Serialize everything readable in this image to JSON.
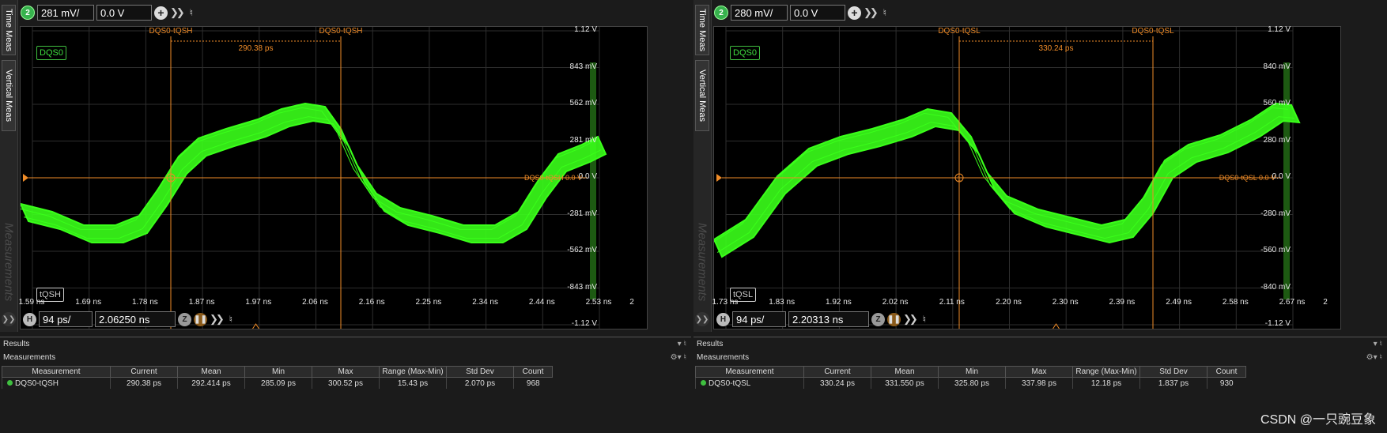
{
  "colors": {
    "trace": "#3aff1a",
    "cursor": "#f08c28",
    "accent": "#3fbf3f"
  },
  "panels": [
    {
      "side_tabs": [
        "Time Meas",
        "Vertical Meas",
        "Measurements"
      ],
      "top": {
        "channel": "2",
        "scale": "281 mV/",
        "offset": "0.0 V"
      },
      "channel_label": "DQS0",
      "meas_label": "tQSH",
      "cursor_label_left": "DQS0-tQSH",
      "cursor_label_right": "DQS0-tQSH",
      "delta_label": "290.38 ps",
      "ground_marker": "DQS0-tQSH 0.0 V",
      "y_labels": [
        "1.12 V",
        "843 mV",
        "562 mV",
        "281 mV",
        "0.0 V",
        "-281 mV",
        "-562 mV",
        "-843 mV",
        "-1.12 V"
      ],
      "x_labels": [
        "1.59 ns",
        "1.69 ns",
        "1.78 ns",
        "1.87 ns",
        "1.97 ns",
        "2.06 ns",
        "2.16 ns",
        "2.25 ns",
        "2.34 ns",
        "2.44 ns",
        "2.53 ns"
      ],
      "x_suffix": "2",
      "bottom": {
        "h": "H",
        "scale": "94 ps/",
        "position": "2.06250 ns"
      },
      "results": {
        "title": "Results",
        "subtitle": "Measurements",
        "columns": [
          "Measurement",
          "Current",
          "Mean",
          "Min",
          "Max",
          "Range (Max-Min)",
          "Std Dev",
          "Count"
        ],
        "row": [
          "DQS0-tQSH",
          "290.38 ps",
          "292.414 ps",
          "285.09 ps",
          "300.52 ps",
          "15.43 ps",
          "2.070 ps",
          "968"
        ]
      }
    },
    {
      "side_tabs": [
        "Time Meas",
        "Vertical Meas",
        "Measurements"
      ],
      "top": {
        "channel": "2",
        "scale": "280 mV/",
        "offset": "0.0 V"
      },
      "channel_label": "DQS0",
      "meas_label": "tQSL",
      "cursor_label_left": "DQS0-tQSL",
      "cursor_label_right": "DQS0-tQSL",
      "delta_label": "330.24 ps",
      "ground_marker": "DQS0-tQSL 0.0 V",
      "y_labels": [
        "1.12 V",
        "840 mV",
        "560 mV",
        "280 mV",
        "0.0 V",
        "-280 mV",
        "-560 mV",
        "-840 mV",
        "-1.12 V"
      ],
      "x_labels": [
        "1.73 ns",
        "1.83 ns",
        "1.92 ns",
        "2.02 ns",
        "2.11 ns",
        "2.20 ns",
        "2.30 ns",
        "2.39 ns",
        "2.49 ns",
        "2.58 ns",
        "2.67 ns"
      ],
      "x_suffix": "2",
      "bottom": {
        "h": "H",
        "scale": "94 ps/",
        "position": "2.20313 ns"
      },
      "results": {
        "title": "Results",
        "subtitle": "Measurements",
        "columns": [
          "Measurement",
          "Current",
          "Mean",
          "Min",
          "Max",
          "Range (Max-Min)",
          "Std Dev",
          "Count"
        ],
        "row": [
          "DQS0-tQSL",
          "330.24 ps",
          "331.550 ps",
          "325.80 ps",
          "337.98 ps",
          "12.18 ps",
          "1.837 ps",
          "930"
        ]
      }
    }
  ],
  "watermark": "CSDN @一只豌豆象"
}
